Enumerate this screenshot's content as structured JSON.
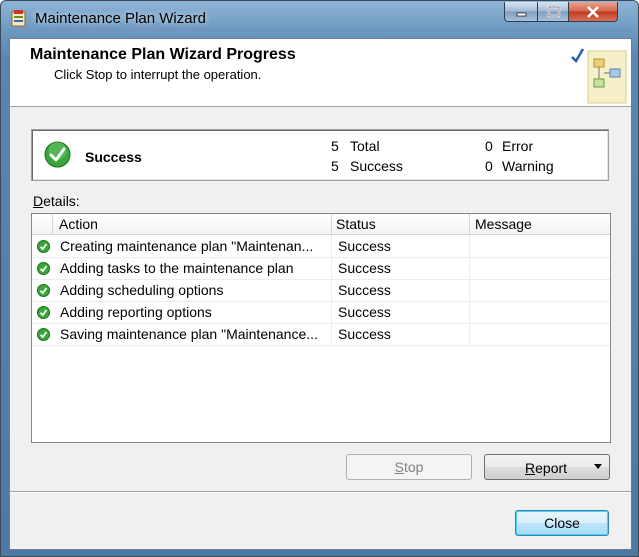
{
  "window": {
    "title": "Maintenance Plan Wizard",
    "controls": {
      "minimize": "minimize",
      "maximize": "maximize",
      "close": "close"
    }
  },
  "header": {
    "title": "Maintenance Plan Wizard Progress",
    "subtitle": "Click Stop to interrupt the operation."
  },
  "summary": {
    "status": "Success",
    "total_count": "5",
    "total_label": "Total",
    "success_count": "5",
    "success_label": "Success",
    "error_count": "0",
    "error_label": "Error",
    "warning_count": "0",
    "warning_label": "Warning"
  },
  "details": {
    "label_accel": "D",
    "label_rest": "etails:",
    "columns": {
      "action": "Action",
      "status": "Status",
      "message": "Message"
    },
    "rows": [
      {
        "action": "Creating maintenance plan \"Maintenan...",
        "status": "Success",
        "message": ""
      },
      {
        "action": "Adding tasks to the maintenance plan",
        "status": "Success",
        "message": ""
      },
      {
        "action": "Adding scheduling options",
        "status": "Success",
        "message": ""
      },
      {
        "action": "Adding reporting options",
        "status": "Success",
        "message": ""
      },
      {
        "action": "Saving maintenance plan \"Maintenance...",
        "status": "Success",
        "message": ""
      }
    ]
  },
  "buttons": {
    "stop_accel": "S",
    "stop_rest": "top",
    "report_accel": "R",
    "report_rest": "eport",
    "close": "Close"
  },
  "colors": {
    "success_green": "#2e9a2e",
    "accent_blue": "#3c7fb1"
  }
}
